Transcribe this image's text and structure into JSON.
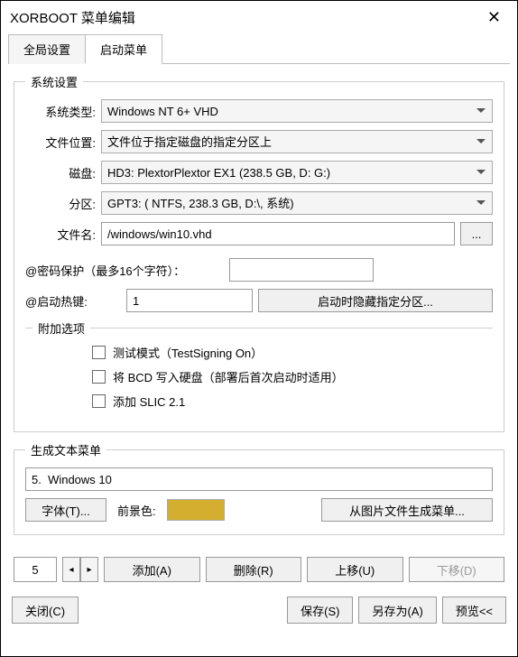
{
  "window": {
    "title": "XORBOOT 菜单编辑"
  },
  "tabs": {
    "global": "全局设置",
    "boot": "启动菜单"
  },
  "system": {
    "legend": "系统设置",
    "type_label": "系统类型:",
    "type_value": "Windows NT 6+ VHD",
    "loc_label": "文件位置:",
    "loc_value": "文件位于指定磁盘的指定分区上",
    "disk_label": "磁盘:",
    "disk_value": "HD3: PlextorPlextor EX1 (238.5 GB, D: G:)",
    "part_label": "分区:",
    "part_value": "GPT3: ( NTFS, 238.3 GB, D:\\, 系统)",
    "file_label": "文件名:",
    "file_value": "/windows/win10.vhd",
    "browse": "...",
    "pw_label": "@密码保护（最多16个字符）：",
    "pw_value": "",
    "hotkey_label": "@启动热键:",
    "hotkey_value": "1",
    "hide_btn": "启动时隐藏指定分区...",
    "attach_legend": "附加选项",
    "cb1": "测试模式（TestSigning On）",
    "cb2": "将 BCD 写入硬盘（部署后首次启动时适用）",
    "cb3": "添加 SLIC 2.1"
  },
  "textmenu": {
    "legend": "生成文本菜单",
    "name": "5.  Windows 10",
    "font_btn": "字体(T)...",
    "fg_label": "前景色:",
    "fg_color": "#d4af2f",
    "genimg_btn": "从图片文件生成菜单..."
  },
  "bottom": {
    "index": "5",
    "arrow_left": "◂",
    "arrow_right": "▸",
    "add": "添加(A)",
    "delete": "删除(R)",
    "up": "上移(U)",
    "down": "下移(D)"
  },
  "footer": {
    "close": "关闭(C)",
    "save": "保存(S)",
    "saveas": "另存为(A)",
    "preview": "预览<<"
  }
}
